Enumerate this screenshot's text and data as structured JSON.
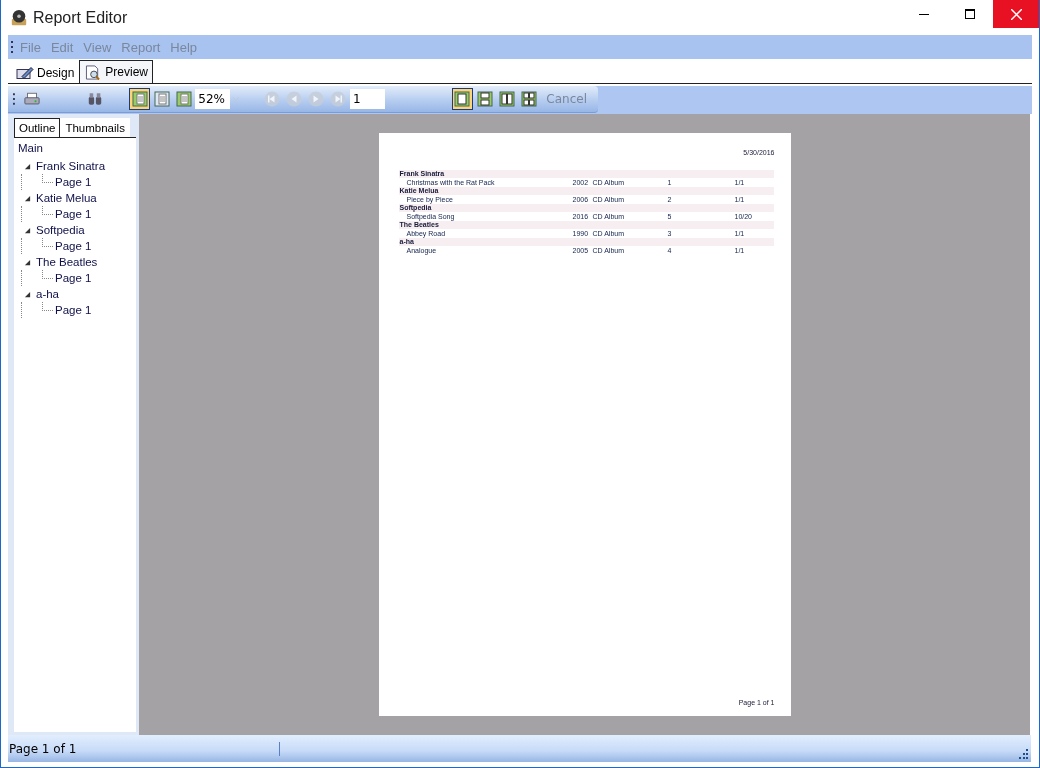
{
  "window": {
    "title": "Report Editor"
  },
  "menu": [
    {
      "label": "File",
      "disabled": true
    },
    {
      "label": "Edit",
      "disabled": true
    },
    {
      "label": "View",
      "disabled": true
    },
    {
      "label": "Report",
      "disabled": true
    },
    {
      "label": "Help",
      "disabled": true
    }
  ],
  "tabs": [
    {
      "label": "Design",
      "selected": false
    },
    {
      "label": "Preview",
      "selected": true
    }
  ],
  "toolbar": {
    "view_buttons": [
      {
        "selected": true
      },
      {
        "selected": false
      },
      {
        "selected": false
      }
    ],
    "zoom": "52%",
    "nav_buttons": [
      {
        "disabled": true
      },
      {
        "disabled": true
      },
      {
        "disabled": true
      },
      {
        "disabled": true
      }
    ],
    "page": "1",
    "layout_buttons": [
      {
        "selected": true
      },
      {
        "selected": false
      },
      {
        "selected": false
      },
      {
        "selected": false
      }
    ],
    "cancel": {
      "label": "Cancel",
      "disabled": true
    }
  },
  "side_tabs": [
    {
      "label": "Outline",
      "selected": true
    },
    {
      "label": "Thumbnails",
      "selected": false
    }
  ],
  "outline": {
    "label": "Main",
    "children": [
      {
        "label": "Frank Sinatra",
        "expanded": true,
        "children": [
          {
            "label": "Page 1"
          }
        ]
      },
      {
        "label": "Katie Melua",
        "expanded": true,
        "children": [
          {
            "label": "Page 1"
          }
        ]
      },
      {
        "label": "Softpedia",
        "expanded": true,
        "children": [
          {
            "label": "Page 1"
          }
        ]
      },
      {
        "label": "The Beatles",
        "expanded": true,
        "children": [
          {
            "label": "Page 1"
          }
        ]
      },
      {
        "label": "a-ha",
        "expanded": true,
        "children": [
          {
            "label": "Page 1"
          }
        ]
      }
    ]
  },
  "report": {
    "date": "5/30/2016",
    "groups": [
      {
        "name": "Frank Sinatra",
        "rows": [
          {
            "title": "Christmas with the Rat Pack",
            "year": "2002",
            "format": "CD Album",
            "column_4": "1",
            "column_5": "1/1"
          }
        ]
      },
      {
        "name": "Katie Melua",
        "rows": [
          {
            "title": "Piece by Piece",
            "year": "2006",
            "format": "CD Album",
            "column_4": "2",
            "column_5": "1/1"
          }
        ]
      },
      {
        "name": "Softpedia",
        "rows": [
          {
            "title": "Softpedia Song",
            "year": "2016",
            "format": "CD Album",
            "column_4": "5",
            "column_5": "10/20"
          }
        ]
      },
      {
        "name": "The Beatles",
        "rows": [
          {
            "title": "Abbey Road",
            "year": "1990",
            "format": "CD Album",
            "column_4": "3",
            "column_5": "1/1"
          }
        ]
      },
      {
        "name": "a-ha",
        "rows": [
          {
            "title": "Analogue",
            "year": "2005",
            "format": "CD Album",
            "column_4": "4",
            "column_5": "1/1"
          }
        ]
      }
    ],
    "footer": "Page 1 of 1"
  },
  "status_bar": {
    "text": "Page 1 of 1"
  }
}
